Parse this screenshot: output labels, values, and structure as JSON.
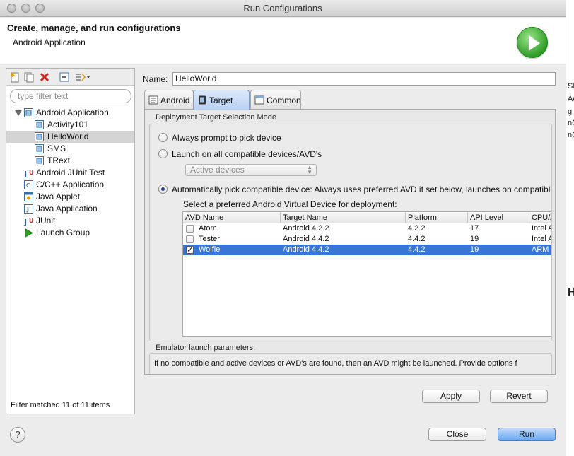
{
  "window": {
    "title": "Run Configurations"
  },
  "header": {
    "title": "Create, manage, and run configurations",
    "subtitle": "Android Application",
    "run_icon": "green-run-arrow-icon"
  },
  "left": {
    "toolbar_icons": [
      "new-config-icon",
      "duplicate-icon",
      "delete-icon",
      "collapse-all-icon",
      "filter-icon"
    ],
    "filter_placeholder": "type filter text",
    "tree": [
      {
        "label": "Android Application",
        "level": 0,
        "expanded": true,
        "icon": "android-app-icon"
      },
      {
        "label": "Activity101",
        "level": 1,
        "icon": "android-app-icon"
      },
      {
        "label": "HelloWorld",
        "level": 1,
        "icon": "android-app-icon",
        "selected": true
      },
      {
        "label": "SMS",
        "level": 1,
        "icon": "android-app-icon"
      },
      {
        "label": "TRext",
        "level": 1,
        "icon": "android-app-icon"
      },
      {
        "label": "Android JUnit Test",
        "level": 0,
        "icon": "android-junit-icon"
      },
      {
        "label": "C/C++ Application",
        "level": 0,
        "icon": "cpp-app-icon"
      },
      {
        "label": "Java Applet",
        "level": 0,
        "icon": "java-applet-icon"
      },
      {
        "label": "Java Application",
        "level": 0,
        "icon": "java-app-icon"
      },
      {
        "label": "JUnit",
        "level": 0,
        "icon": "junit-icon"
      },
      {
        "label": "Launch Group",
        "level": 0,
        "icon": "launch-group-icon"
      }
    ],
    "filter_status": "Filter matched 11 of 11 items"
  },
  "main": {
    "name_label": "Name:",
    "name_value": "HelloWorld",
    "tabs": [
      {
        "label": "Android",
        "icon": "android-tab-icon"
      },
      {
        "label": "Target",
        "icon": "target-tab-icon",
        "active": true
      },
      {
        "label": "Common",
        "icon": "common-tab-icon"
      }
    ],
    "deployment": {
      "title": "Deployment Target Selection Mode",
      "options": [
        {
          "label": "Always prompt to pick device",
          "checked": false
        },
        {
          "label": "Launch on all compatible devices/AVD's",
          "checked": false
        },
        {
          "label": "Automatically pick compatible device: Always uses preferred AVD if set below, launches on compatible",
          "checked": true
        }
      ],
      "device_select": "Active devices",
      "avd_caption": "Select a preferred Android Virtual Device for deployment:",
      "avd_columns": [
        "AVD Name",
        "Target Name",
        "Platform",
        "API Level",
        "CPU/AB"
      ],
      "avd_rows": [
        {
          "checked": false,
          "name": "Atom",
          "target": "Android 4.2.2",
          "platform": "4.2.2",
          "api": "17",
          "cpu": "Intel At",
          "selected": false
        },
        {
          "checked": false,
          "name": "Tester",
          "target": "Android 4.4.2",
          "platform": "4.4.2",
          "api": "19",
          "cpu": "Intel At",
          "selected": false
        },
        {
          "checked": true,
          "name": "Wolfie",
          "target": "Android 4.4.2",
          "platform": "4.4.2",
          "api": "19",
          "cpu": "ARM (a",
          "selected": true
        }
      ]
    },
    "emulator": {
      "title": "Emulator launch parameters:",
      "text": "If no compatible and active devices or AVD's are found, then an AVD might be launched. Provide options f"
    },
    "apply_label": "Apply",
    "revert_label": "Revert"
  },
  "footer": {
    "help_label": "?",
    "close_label": "Close",
    "run_label": "Run"
  },
  "background_app_text": [
    "SE",
    "Ac",
    "g",
    "nC",
    "nC",
    "H"
  ]
}
